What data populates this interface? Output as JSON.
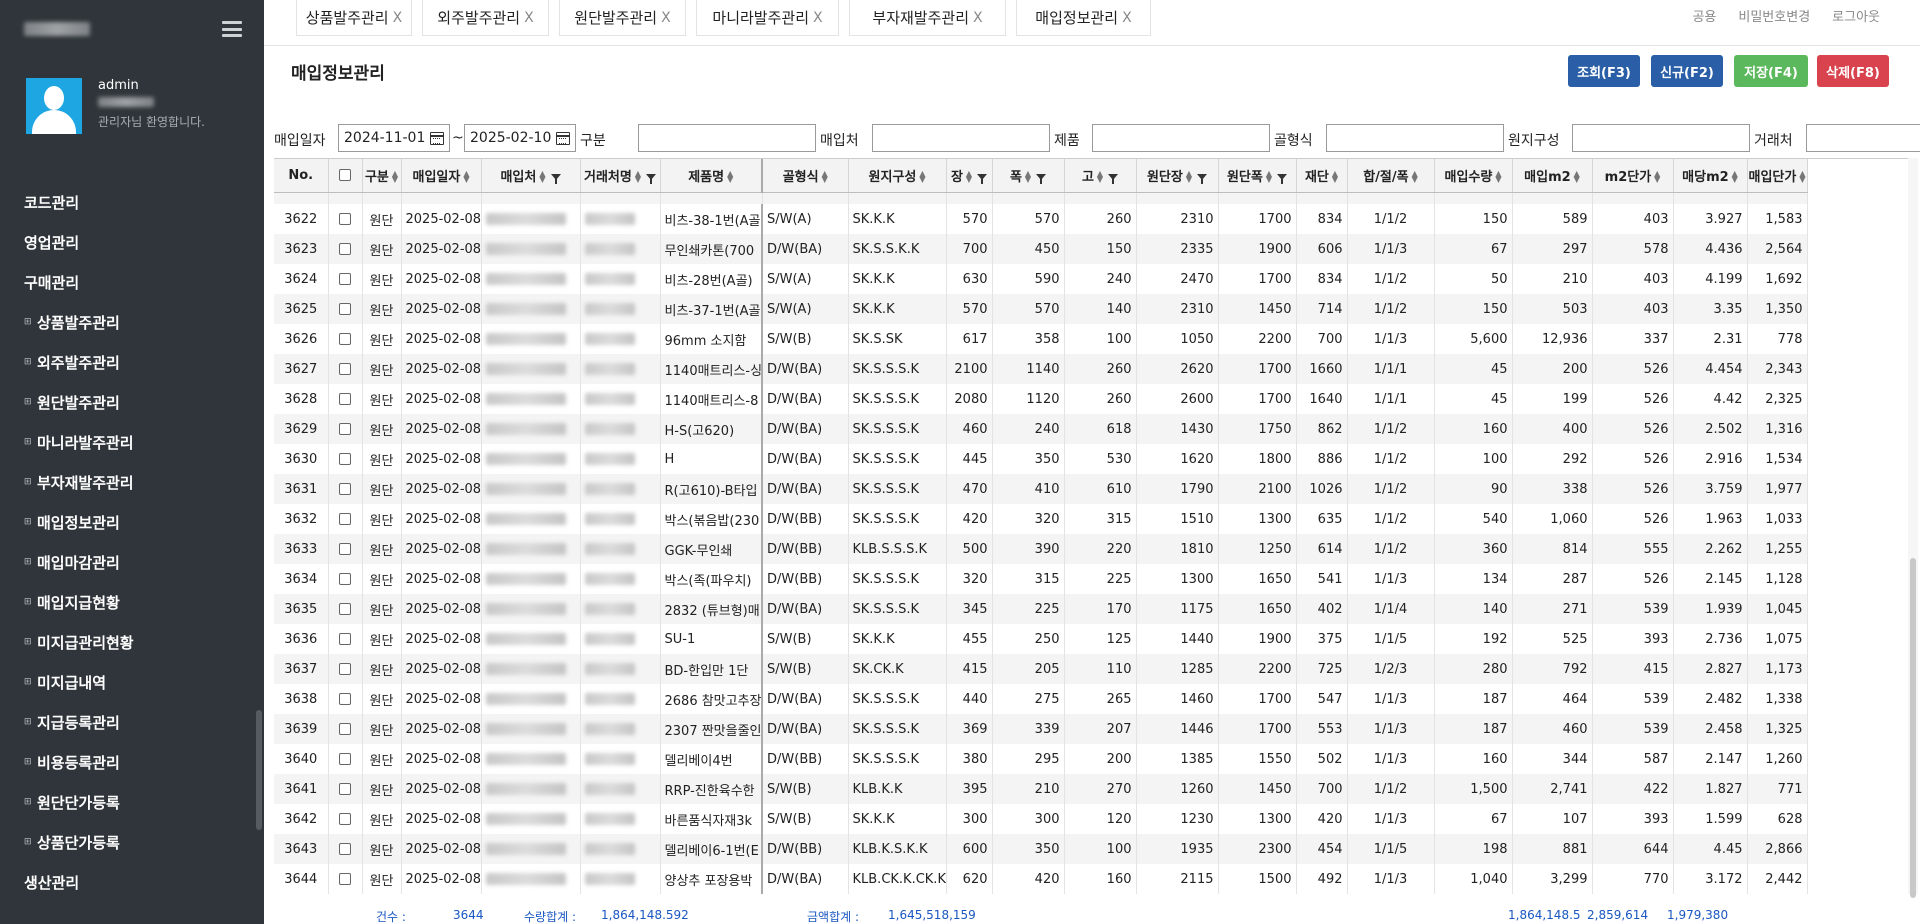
{
  "sidebar": {
    "user_name": "admin",
    "greeting": "관리자님 환영합니다.",
    "menu": [
      {
        "label": "코드관리",
        "sub": false
      },
      {
        "label": "영업관리",
        "sub": false
      },
      {
        "label": "구매관리",
        "sub": false
      },
      {
        "label": "상품발주관리",
        "sub": true
      },
      {
        "label": "외주발주관리",
        "sub": true
      },
      {
        "label": "원단발주관리",
        "sub": true
      },
      {
        "label": "마니라발주관리",
        "sub": true
      },
      {
        "label": "부자재발주관리",
        "sub": true
      },
      {
        "label": "매입정보관리",
        "sub": true
      },
      {
        "label": "매입마감관리",
        "sub": true
      },
      {
        "label": "매입지급현황",
        "sub": true
      },
      {
        "label": "미지급관리현황",
        "sub": true
      },
      {
        "label": "미지급내역",
        "sub": true
      },
      {
        "label": "지급등록관리",
        "sub": true
      },
      {
        "label": "비용등록관리",
        "sub": true
      },
      {
        "label": "원단단가등록",
        "sub": true
      },
      {
        "label": "상품단가등록",
        "sub": true
      },
      {
        "label": "생산관리",
        "sub": false
      }
    ]
  },
  "tabs": [
    "상품발주관리",
    "외주발주관리",
    "원단발주관리",
    "마니라발주관리",
    "부자재발주관리",
    "매입정보관리"
  ],
  "tab_close": "X",
  "toplinks": [
    "공용",
    "비밀번호변경",
    "로그아웃"
  ],
  "page_title": "매입정보관리",
  "buttons": {
    "search": "조회(F3)",
    "new": "신규(F2)",
    "save": "저장(F4)",
    "delete": "삭제(F8)"
  },
  "filters": {
    "date_label": "매입일자",
    "date_from": "2024-11-01",
    "tilde": "~",
    "date_to": "2025-02-10",
    "labels": [
      "구분",
      "매입처",
      "제품",
      "골형식",
      "원지구성",
      "거래처"
    ]
  },
  "columns": [
    "No.",
    "",
    "구분",
    "매입일자",
    "매입처",
    "거래처명",
    "제품명",
    "골형식",
    "원지구성",
    "장",
    "폭",
    "고",
    "원단장",
    "원단폭",
    "재단",
    "합/절/폭",
    "매입수량",
    "매입m2",
    "m2단가",
    "매당m2",
    "매입단가"
  ],
  "rows": [
    [
      "3622",
      "원단",
      "2025-02-08",
      "비츠-38-1번(A골",
      "S/W(A)",
      "SK.K.K",
      "570",
      "570",
      "260",
      "2310",
      "1700",
      "834",
      "1/1/2",
      "150",
      "589",
      "403",
      "3.927",
      "1,583"
    ],
    [
      "3623",
      "원단",
      "2025-02-08",
      "무인쇄카톤(700",
      "D/W(BA)",
      "SK.S.S.K.K",
      "700",
      "450",
      "150",
      "2335",
      "1900",
      "606",
      "1/1/3",
      "67",
      "297",
      "578",
      "4.436",
      "2,564"
    ],
    [
      "3624",
      "원단",
      "2025-02-08",
      "비츠-28번(A골)",
      "S/W(A)",
      "SK.K.K",
      "630",
      "590",
      "240",
      "2470",
      "1700",
      "834",
      "1/1/2",
      "50",
      "210",
      "403",
      "4.199",
      "1,692"
    ],
    [
      "3625",
      "원단",
      "2025-02-08",
      "비츠-37-1번(A골",
      "S/W(A)",
      "SK.K.K",
      "570",
      "570",
      "140",
      "2310",
      "1450",
      "714",
      "1/1/2",
      "150",
      "503",
      "403",
      "3.35",
      "1,350"
    ],
    [
      "3626",
      "원단",
      "2025-02-08",
      "96mm 소지함",
      "S/W(B)",
      "SK.S.SK",
      "617",
      "358",
      "100",
      "1050",
      "2200",
      "700",
      "1/1/3",
      "5,600",
      "12,936",
      "337",
      "2.31",
      "778"
    ],
    [
      "3627",
      "원단",
      "2025-02-08",
      "1140매트리스-싱",
      "D/W(BA)",
      "SK.S.S.S.K",
      "2100",
      "1140",
      "260",
      "2620",
      "1700",
      "1660",
      "1/1/1",
      "45",
      "200",
      "526",
      "4.454",
      "2,343"
    ],
    [
      "3628",
      "원단",
      "2025-02-08",
      "1140매트리스-8",
      "D/W(BA)",
      "SK.S.S.S.K",
      "2080",
      "1120",
      "260",
      "2600",
      "1700",
      "1640",
      "1/1/1",
      "45",
      "199",
      "526",
      "4.42",
      "2,325"
    ],
    [
      "3629",
      "원단",
      "2025-02-08",
      "H-S(고620)",
      "D/W(BA)",
      "SK.S.S.S.K",
      "460",
      "240",
      "618",
      "1430",
      "1750",
      "862",
      "1/1/2",
      "160",
      "400",
      "526",
      "2.502",
      "1,316"
    ],
    [
      "3630",
      "원단",
      "2025-02-08",
      "H",
      "D/W(BA)",
      "SK.S.S.S.K",
      "445",
      "350",
      "530",
      "1620",
      "1800",
      "886",
      "1/1/2",
      "100",
      "292",
      "526",
      "2.916",
      "1,534"
    ],
    [
      "3631",
      "원단",
      "2025-02-08",
      "R(고610)-B타입",
      "D/W(BA)",
      "SK.S.S.S.K",
      "470",
      "410",
      "610",
      "1790",
      "2100",
      "1026",
      "1/1/2",
      "90",
      "338",
      "526",
      "3.759",
      "1,977"
    ],
    [
      "3632",
      "원단",
      "2025-02-08",
      "박스(볶음밥(230",
      "D/W(BB)",
      "SK.S.S.S.K",
      "420",
      "320",
      "315",
      "1510",
      "1300",
      "635",
      "1/1/2",
      "540",
      "1,060",
      "526",
      "1.963",
      "1,033"
    ],
    [
      "3633",
      "원단",
      "2025-02-08",
      "GGK-무인쇄",
      "D/W(BB)",
      "KLB.S.S.S.K",
      "500",
      "390",
      "220",
      "1810",
      "1250",
      "614",
      "1/1/2",
      "360",
      "814",
      "555",
      "2.262",
      "1,255"
    ],
    [
      "3634",
      "원단",
      "2025-02-08",
      "박스(족(파우치)",
      "D/W(BB)",
      "SK.S.S.S.K",
      "320",
      "315",
      "225",
      "1300",
      "1650",
      "541",
      "1/1/3",
      "134",
      "287",
      "526",
      "2.145",
      "1,128"
    ],
    [
      "3635",
      "원단",
      "2025-02-08",
      "2832 (튜브형)매",
      "D/W(BA)",
      "SK.S.S.S.K",
      "345",
      "225",
      "170",
      "1175",
      "1650",
      "402",
      "1/1/4",
      "140",
      "271",
      "539",
      "1.939",
      "1,045"
    ],
    [
      "3636",
      "원단",
      "2025-02-08",
      "SU-1",
      "S/W(B)",
      "SK.K.K",
      "455",
      "250",
      "125",
      "1440",
      "1900",
      "375",
      "1/1/5",
      "192",
      "525",
      "393",
      "2.736",
      "1,075"
    ],
    [
      "3637",
      "원단",
      "2025-02-08",
      "BD-한입만 1단",
      "S/W(B)",
      "SK.CK.K",
      "415",
      "205",
      "110",
      "1285",
      "2200",
      "725",
      "1/2/3",
      "280",
      "792",
      "415",
      "2.827",
      "1,173"
    ],
    [
      "3638",
      "원단",
      "2025-02-08",
      "2686 참맛고추장",
      "D/W(BA)",
      "SK.S.S.S.K",
      "440",
      "275",
      "265",
      "1460",
      "1700",
      "547",
      "1/1/3",
      "187",
      "464",
      "539",
      "2.482",
      "1,338"
    ],
    [
      "3639",
      "원단",
      "2025-02-08",
      "2307 짠맛을줄인",
      "D/W(BA)",
      "SK.S.S.S.K",
      "369",
      "339",
      "207",
      "1446",
      "1700",
      "553",
      "1/1/3",
      "187",
      "460",
      "539",
      "2.458",
      "1,325"
    ],
    [
      "3640",
      "원단",
      "2025-02-08",
      "델리베이4번",
      "D/W(BB)",
      "SK.S.S.S.K",
      "380",
      "295",
      "200",
      "1385",
      "1550",
      "502",
      "1/1/3",
      "160",
      "344",
      "587",
      "2.147",
      "1,260"
    ],
    [
      "3641",
      "원단",
      "2025-02-08",
      "RRP-진한육수한",
      "S/W(B)",
      "KLB.K.K",
      "395",
      "210",
      "270",
      "1260",
      "1450",
      "700",
      "1/1/2",
      "1,500",
      "2,741",
      "422",
      "1.827",
      "771"
    ],
    [
      "3642",
      "원단",
      "2025-02-08",
      "바른품식자재3k",
      "S/W(B)",
      "SK.K.K",
      "300",
      "300",
      "120",
      "1230",
      "1300",
      "420",
      "1/1/3",
      "67",
      "107",
      "393",
      "1.599",
      "628"
    ],
    [
      "3643",
      "원단",
      "2025-02-08",
      "델리베이6-1번(E",
      "D/W(BB)",
      "KLB.K.S.K.K",
      "600",
      "350",
      "100",
      "1935",
      "2300",
      "454",
      "1/1/5",
      "198",
      "881",
      "644",
      "4.45",
      "2,866"
    ],
    [
      "3644",
      "원단",
      "2025-02-08",
      "양상추 포장용박",
      "D/W(BA)",
      "KLB.CK.K.CK.Kl",
      "620",
      "420",
      "160",
      "2115",
      "1500",
      "492",
      "1/1/3",
      "1,040",
      "3,299",
      "770",
      "3.172",
      "2,442"
    ]
  ],
  "footer": {
    "count_label": "건수 :",
    "count_value": "3644",
    "qty_label": "수량합계 :",
    "qty_value": "1,864,148.592",
    "amount_label": "금액합계 :",
    "amount_value": "1,645,518,159",
    "sum_qty": "1,864,148.5",
    "sum_m2": "2,859,614",
    "sum_m2price": "1,979,380"
  }
}
